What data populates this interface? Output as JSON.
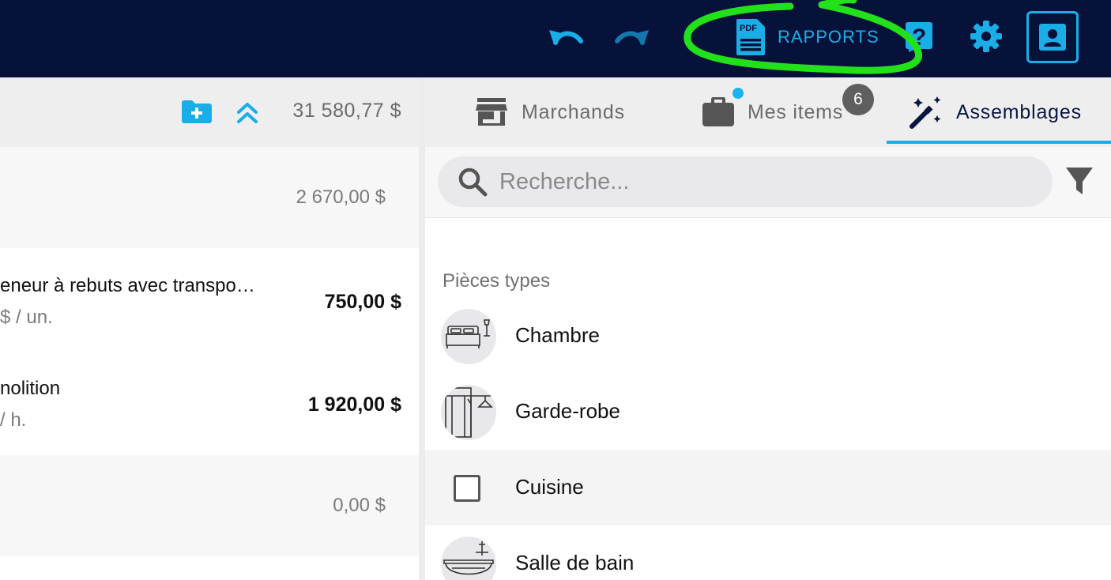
{
  "topbar": {
    "reports_label": "RAPPORTS",
    "reports_icon_text": "PDF",
    "help_glyph": "?",
    "icons": [
      "undo-icon",
      "redo-icon",
      "pdf-document-icon",
      "help-icon",
      "gear-icon",
      "account-icon"
    ],
    "colors": {
      "background": "#07123b",
      "accent": "#1aaee8",
      "annotation": "#22e01a"
    }
  },
  "left": {
    "total": "31 580,77 $",
    "rows": [
      {
        "amount": "2 670,00 $"
      },
      {
        "title": "eneur à rebuts avec transpo…",
        "sub": "$ / un.",
        "amount": "750,00 $"
      },
      {
        "title": "nolition",
        "sub": "/ h.",
        "amount": "1 920,00 $"
      },
      {
        "amount": "0,00 $"
      }
    ]
  },
  "tabs": [
    {
      "label": "Marchands",
      "icon": "store-icon"
    },
    {
      "label": "Mes items",
      "icon": "briefcase-icon",
      "badge": "6"
    },
    {
      "label": "Assemblages",
      "icon": "magic-wand-icon",
      "active": true
    }
  ],
  "search": {
    "placeholder": "Recherche..."
  },
  "pieces": {
    "section_title": "Pièces types",
    "items": [
      {
        "label": "Chambre",
        "icon": "bedroom-icon"
      },
      {
        "label": "Garde-robe",
        "icon": "closet-icon"
      },
      {
        "label": "Cuisine",
        "icon": "checkbox"
      },
      {
        "label": "Salle de bain",
        "icon": "bathtub-icon"
      }
    ]
  }
}
